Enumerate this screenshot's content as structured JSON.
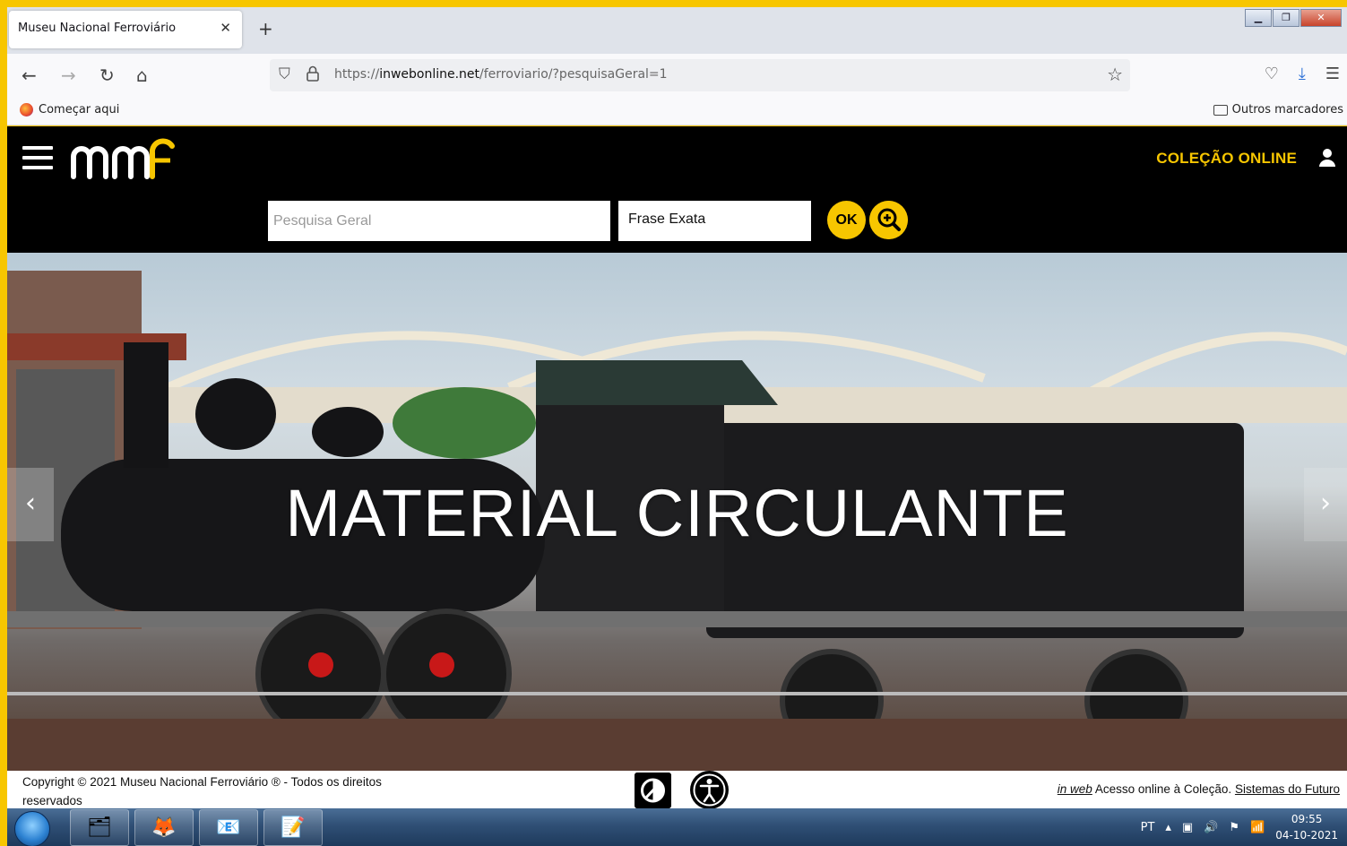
{
  "browser": {
    "tab_title": "Museu Nacional Ferroviário",
    "url_prefix": "https://",
    "url_domain": "inwebonline.net",
    "url_path": "/ferroviario/?pesquisaGeral=1",
    "bookmark_left": "Começar aqui",
    "bookmark_right": "Outros marcadores"
  },
  "site": {
    "collection_link": "COLEÇÃO ONLINE",
    "search_placeholder": "Pesquisa Geral",
    "search_mode": "Frase Exata",
    "ok_label": "OK",
    "hero_title": "MATERIAL CIRCULANTE"
  },
  "footer": {
    "copyright": "Copyright © 2021 Museu Nacional Ferroviário ® - Todos os direitos reservados",
    "inweb_link": "in web",
    "access_text": " Acesso online à Coleção. ",
    "sistemas_link": "Sistemas do Futuro"
  },
  "taskbar": {
    "language": "PT",
    "time": "09:55",
    "date": "04-10-2021"
  },
  "colors": {
    "accent": "#f7c600",
    "header_bg": "#000000"
  }
}
